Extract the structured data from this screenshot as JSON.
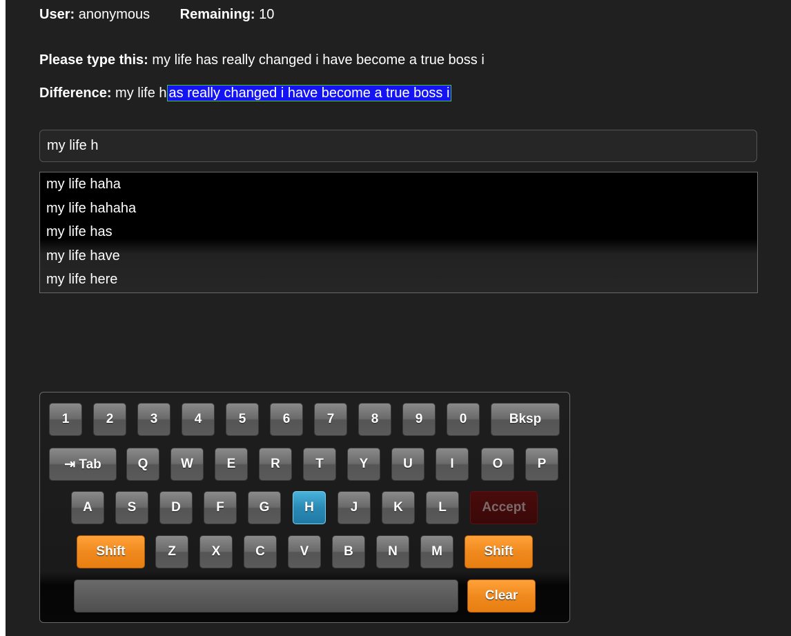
{
  "status": {
    "user_label": "User:",
    "user_value": "anonymous",
    "remaining_label": "Remaining:",
    "remaining_value": "10"
  },
  "prompt": {
    "label": "Please type this:",
    "text": "my life has really changed i have become a true boss i"
  },
  "difference": {
    "label": "Difference:",
    "matched": "my life h",
    "remaining": "as really changed i have become a true boss i"
  },
  "input": {
    "value": "my life h"
  },
  "suggestions": [
    "my life haha",
    "my life hahaha",
    "my life has",
    "my life have",
    "my life here"
  ],
  "keyboard": {
    "row1": [
      "1",
      "2",
      "3",
      "4",
      "5",
      "6",
      "7",
      "8",
      "9",
      "0",
      "Bksp"
    ],
    "row2": [
      "⇥ Tab",
      "Q",
      "W",
      "E",
      "R",
      "T",
      "Y",
      "U",
      "I",
      "O",
      "P"
    ],
    "row3": [
      "A",
      "S",
      "D",
      "F",
      "G",
      "H",
      "J",
      "K",
      "L",
      "Accept"
    ],
    "row4": [
      "Shift",
      "Z",
      "X",
      "C",
      "V",
      "B",
      "N",
      "M",
      "Shift"
    ],
    "row5": [
      "",
      "Clear"
    ],
    "active_key": "H"
  },
  "colors": {
    "background": "#202020",
    "diff_highlight": "#1414f2",
    "key_active": "#2a8ab4",
    "key_orange": "#f08a1e",
    "accept_disabled": "#3a0808"
  }
}
